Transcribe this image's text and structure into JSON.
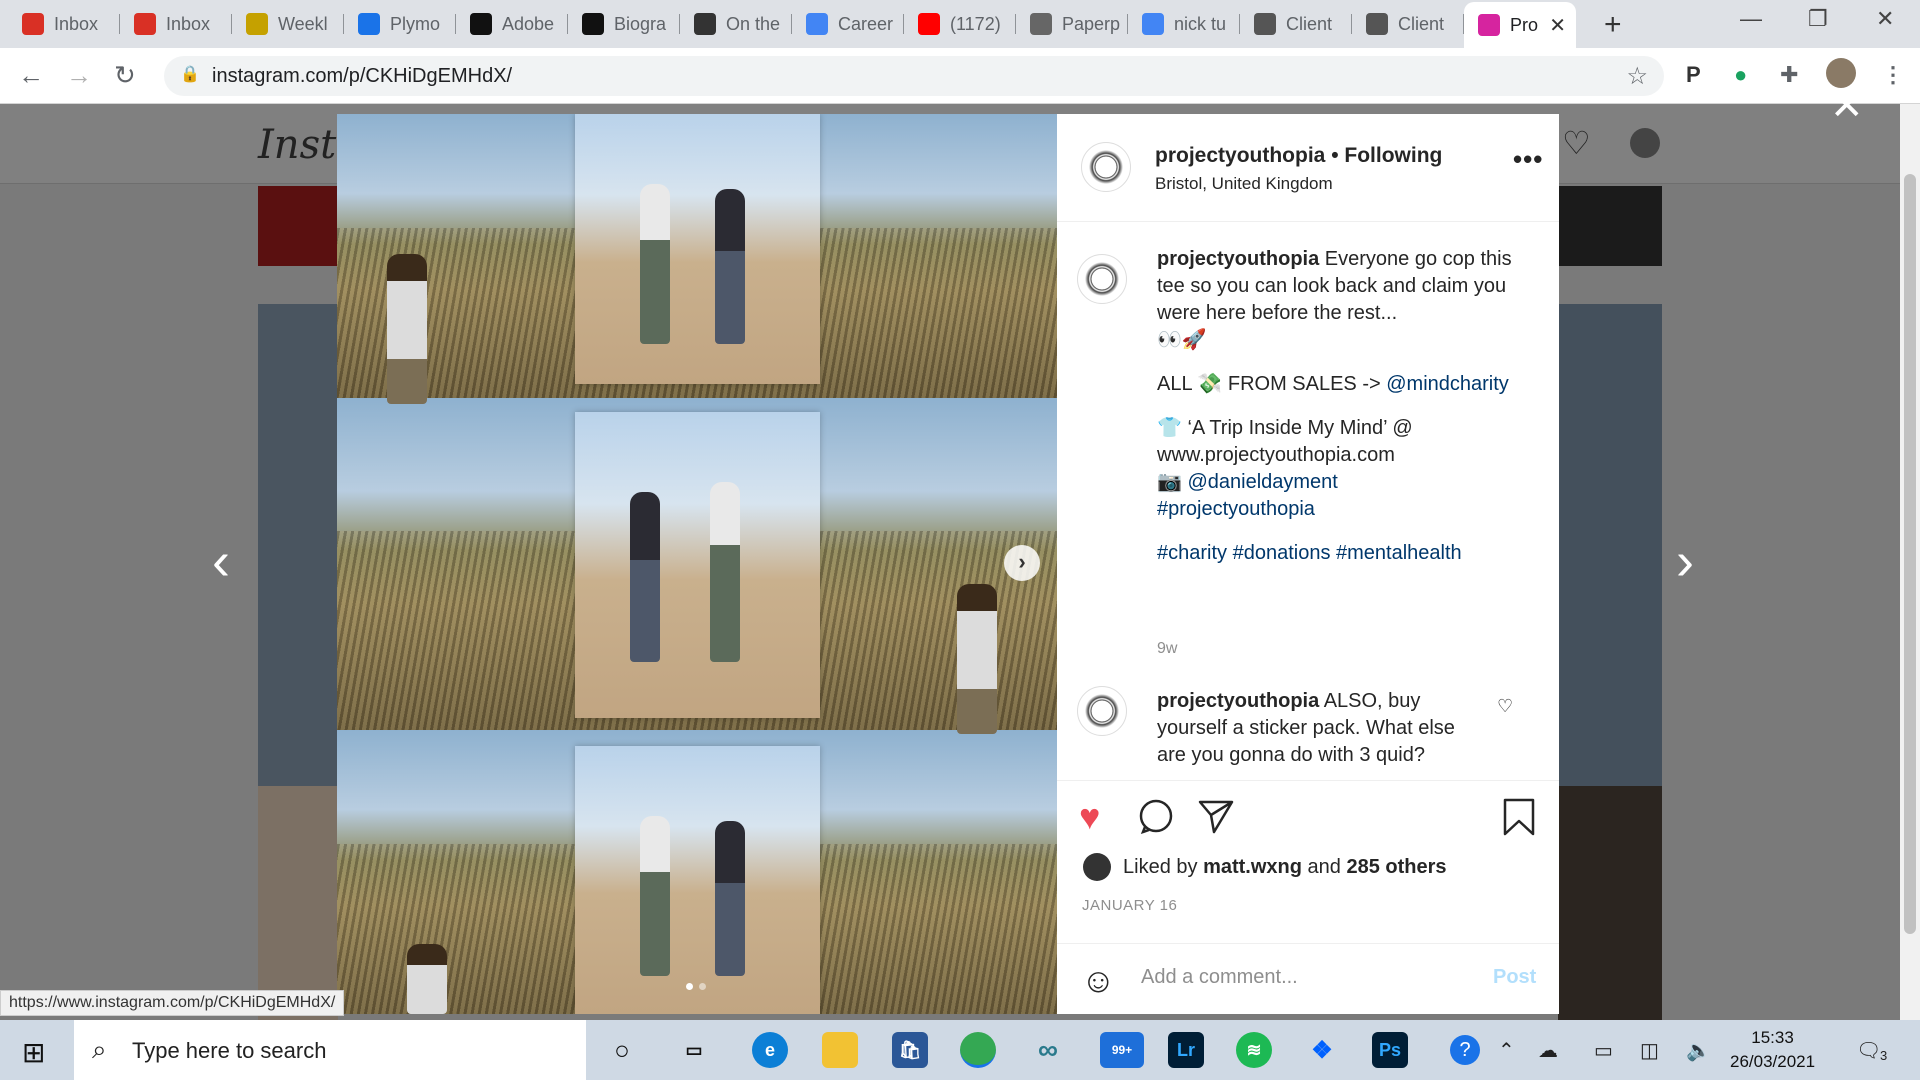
{
  "browser": {
    "tabs": [
      {
        "label": "Inbox",
        "icon": "gmail-icon",
        "color": "#d93025"
      },
      {
        "label": "Inbox",
        "icon": "gmail-icon",
        "color": "#d93025"
      },
      {
        "label": "Weekl",
        "icon": "calendar-icon",
        "color": "#c5a100"
      },
      {
        "label": "Plymo",
        "icon": "calendar-26-icon",
        "color": "#1a73e8"
      },
      {
        "label": "Adobe",
        "icon": "pf-icon",
        "color": "#111111"
      },
      {
        "label": "Biogra",
        "icon": "notion-icon",
        "color": "#111111"
      },
      {
        "label": "On the",
        "icon": "scissors-icon",
        "color": "#333333"
      },
      {
        "label": "Career",
        "icon": "docs-icon",
        "color": "#4285f4"
      },
      {
        "label": "(1172)",
        "icon": "youtube-icon",
        "color": "#ff0000"
      },
      {
        "label": "Paperp",
        "icon": "p-icon",
        "color": "#666666"
      },
      {
        "label": "nick tu",
        "icon": "google-icon",
        "color": "#4285f4"
      },
      {
        "label": "Client",
        "icon": "box-icon",
        "color": "#555555"
      },
      {
        "label": "Client",
        "icon": "box-icon",
        "color": "#555555"
      },
      {
        "label": "Pro",
        "icon": "instagram-icon",
        "color": "#d6249f"
      }
    ],
    "url": "instagram.com/p/CKHiDgEMHdX/",
    "status_url": "https://www.instagram.com/p/CKHiDgEMHdX/"
  },
  "instagram": {
    "logo_text": "Insta",
    "post": {
      "username": "projectyouthopia",
      "follow_status": "• Following",
      "location": "Bristol, United Kingdom",
      "caption": {
        "username": "projectyouthopia",
        "line1": "Everyone go cop this tee so you can look back and claim you were here before the rest...",
        "emoji1": "👀🚀",
        "line2_prefix": "ALL 💸 FROM SALES ->",
        "line2_mention": "@mindcharity",
        "line3": "👕 ‘A Trip Inside My Mind’ @ www.projectyouthopia.com",
        "line4_prefix": "📷",
        "line4_mention": "@danieldayment",
        "tag1": "#projectyouthopia",
        "tags": "#charity #donations #mentalhealth",
        "time": "9w"
      },
      "comment": {
        "username": "projectyouthopia",
        "text": "ALSO, buy yourself a sticker pack. What else are you gonna do with 3 quid?"
      },
      "likes": {
        "prefix": "Liked by",
        "user": "matt.wxng",
        "joiner": "and",
        "others": "285 others"
      },
      "date": "JANUARY 16",
      "comment_placeholder": "Add a comment...",
      "post_button": "Post"
    }
  },
  "taskbar": {
    "search_placeholder": "Type here to search",
    "time": "15:33",
    "date": "26/03/2021",
    "mail_badge": "99+",
    "notification_count": "3"
  },
  "colors": {
    "accent_link": "#00376b",
    "like_red": "#ed4956",
    "post_button": "#b2dffc"
  }
}
